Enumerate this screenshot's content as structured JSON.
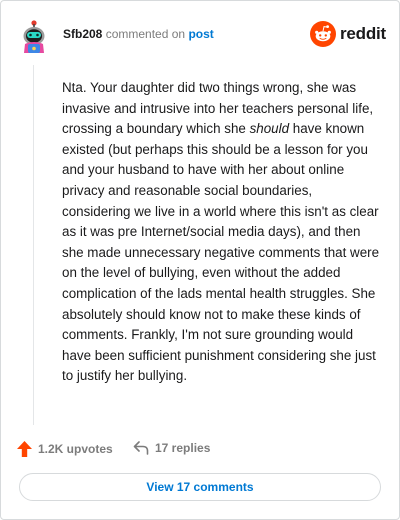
{
  "header": {
    "username": "Sfb208",
    "action_text": "commented on",
    "post_link": "post",
    "brand_wordmark": "reddit"
  },
  "comment": {
    "parts": [
      "Nta. Your daughter did two things wrong, she was invasive and intrusive into her teachers personal life, crossing a boundary which she ",
      "should",
      " have known existed (but perhaps this should be a lesson for you and your husband to have with her about online privacy and reasonable social boundaries, considering we live in a world where this isn't as clear as it was pre Internet/social media days), and then she made unnecessary negative comments that were on the level of bullying, even without the added complication of the lads mental health struggles. She absolutely should know not to make these kinds of comments. Frankly, I'm not sure grounding would have been sufficient punishment considering she just to justify her bullying."
    ]
  },
  "actions": {
    "upvotes": "1.2K upvotes",
    "replies": "17 replies"
  },
  "view_button": "View 17 comments",
  "colors": {
    "brand": "#ff4500",
    "link": "#0079d3",
    "muted": "#7c7c7c",
    "border": "#d7dadc"
  }
}
